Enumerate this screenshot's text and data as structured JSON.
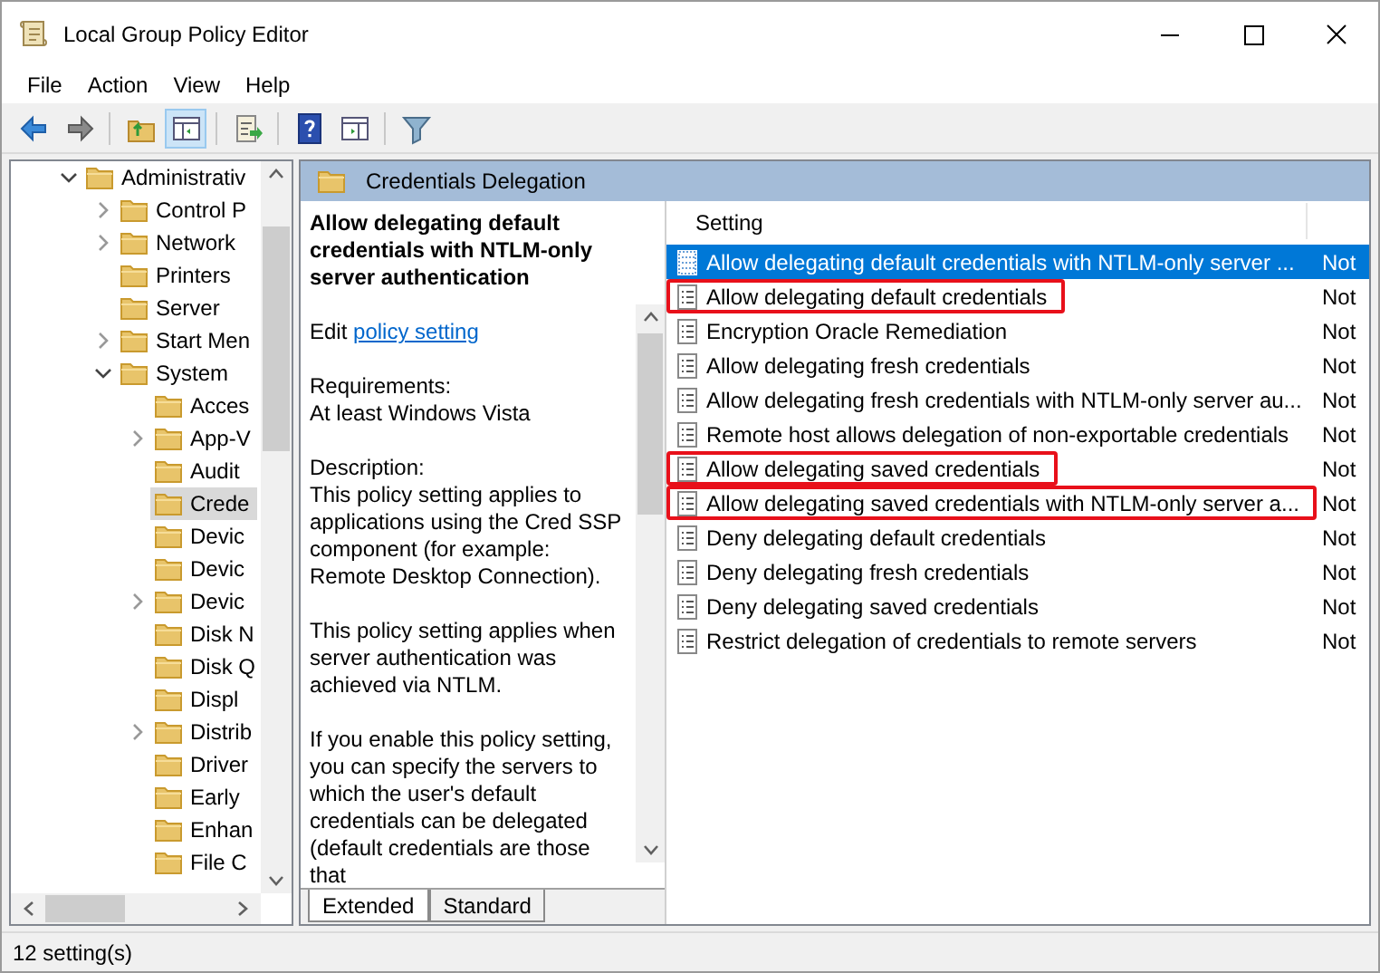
{
  "window": {
    "title": "Local Group Policy Editor"
  },
  "menu": [
    "File",
    "Action",
    "View",
    "Help"
  ],
  "toolbar": [
    {
      "kind": "back",
      "pressed": false
    },
    {
      "kind": "forward",
      "pressed": false
    },
    {
      "kind": "sep"
    },
    {
      "kind": "up",
      "pressed": false
    },
    {
      "kind": "tree",
      "pressed": true
    },
    {
      "kind": "sep"
    },
    {
      "kind": "export",
      "pressed": false
    },
    {
      "kind": "sep"
    },
    {
      "kind": "help",
      "pressed": false
    },
    {
      "kind": "pane",
      "pressed": false
    },
    {
      "kind": "sep"
    },
    {
      "kind": "filter",
      "pressed": false
    }
  ],
  "tree": [
    {
      "label": "Administrativ",
      "expanded": true,
      "selected": false,
      "children": [
        {
          "label": "Control P",
          "expandable": true,
          "selected": false
        },
        {
          "label": "Network",
          "expandable": true,
          "selected": false
        },
        {
          "label": "Printers",
          "selected": false
        },
        {
          "label": "Server",
          "selected": false
        },
        {
          "label": "Start Men",
          "expandable": true,
          "selected": false
        },
        {
          "label": "System",
          "expanded": true,
          "selected": false,
          "children": [
            {
              "label": "Acces",
              "selected": false
            },
            {
              "label": "App-V",
              "expandable": true,
              "selected": false
            },
            {
              "label": "Audit",
              "selected": false
            },
            {
              "label": "Crede",
              "selected": true
            },
            {
              "label": "Devic",
              "selected": false
            },
            {
              "label": "Devic",
              "selected": false
            },
            {
              "label": "Devic",
              "expandable": true,
              "selected": false
            },
            {
              "label": "Disk N",
              "selected": false
            },
            {
              "label": "Disk Q",
              "selected": false
            },
            {
              "label": "Displ",
              "selected": false
            },
            {
              "label": "Distrib",
              "expandable": true,
              "selected": false
            },
            {
              "label": "Driver",
              "selected": false
            },
            {
              "label": "Early",
              "selected": false
            },
            {
              "label": "Enhan",
              "selected": false
            },
            {
              "label": "File C",
              "selected": false
            }
          ]
        }
      ]
    }
  ],
  "panel_title": "Credentials Delegation",
  "description": {
    "title": "Allow delegating default credentials with NTLM-only server authentication",
    "edit_prefix": "Edit",
    "edit_link": "policy setting",
    "requirements_label": "Requirements:",
    "requirements": "At least Windows Vista",
    "description_label": "Description:",
    "paragraphs": [
      "This policy setting applies to applications using the Cred SSP component (for example: Remote Desktop Connection).",
      "This policy setting applies when server authentication was achieved via NTLM.",
      "If you enable this policy setting, you can specify the servers to which the user's default credentials can be delegated (default credentials are those that"
    ]
  },
  "table": {
    "columns": [
      "Setting"
    ],
    "rows": [
      {
        "setting": "Allow delegating default credentials with NTLM-only server ...",
        "state": "Not",
        "selected": true,
        "highlighted": false
      },
      {
        "setting": "Allow delegating default credentials",
        "state": "Not",
        "selected": false,
        "highlighted": true
      },
      {
        "setting": "Encryption Oracle Remediation",
        "state": "Not",
        "selected": false,
        "highlighted": false
      },
      {
        "setting": "Allow delegating fresh credentials",
        "state": "Not",
        "selected": false,
        "highlighted": false
      },
      {
        "setting": "Allow delegating fresh credentials with NTLM-only server au...",
        "state": "Not",
        "selected": false,
        "highlighted": false
      },
      {
        "setting": "Remote host allows delegation of non-exportable credentials",
        "state": "Not",
        "selected": false,
        "highlighted": false
      },
      {
        "setting": "Allow delegating saved credentials",
        "state": "Not",
        "selected": false,
        "highlighted": true
      },
      {
        "setting": "Allow delegating saved credentials with NTLM-only server a...",
        "state": "Not",
        "selected": false,
        "highlighted": true
      },
      {
        "setting": "Deny delegating default credentials",
        "state": "Not",
        "selected": false,
        "highlighted": false
      },
      {
        "setting": "Deny delegating fresh credentials",
        "state": "Not",
        "selected": false,
        "highlighted": false
      },
      {
        "setting": "Deny delegating saved credentials",
        "state": "Not",
        "selected": false,
        "highlighted": false
      },
      {
        "setting": "Restrict delegation of credentials to remote servers",
        "state": "Not",
        "selected": false,
        "highlighted": false
      }
    ]
  },
  "tabs": [
    {
      "label": "Extended",
      "selected": true
    },
    {
      "label": "Standard",
      "selected": false
    }
  ],
  "status_bar": "12 setting(s)"
}
